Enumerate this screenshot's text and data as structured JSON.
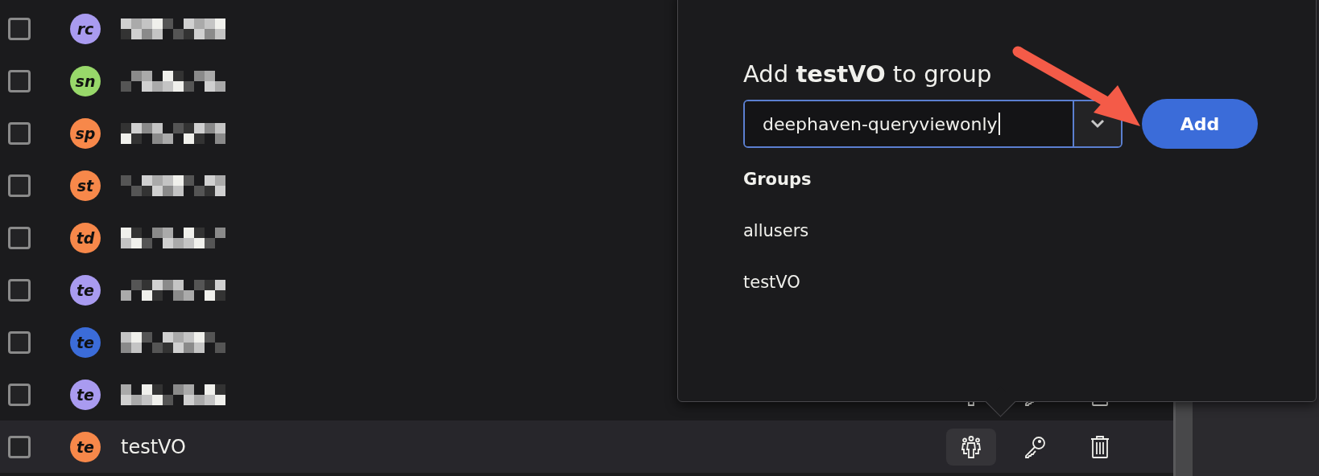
{
  "users": [
    {
      "kind": "redacted",
      "initials": "rc",
      "color": "#a99bf0",
      "checked": false,
      "hovered": false
    },
    {
      "kind": "redacted",
      "initials": "sn",
      "color": "#98d86a",
      "checked": false,
      "hovered": false
    },
    {
      "kind": "redacted",
      "initials": "sp",
      "color": "#f7884a",
      "checked": false,
      "hovered": false
    },
    {
      "kind": "redacted",
      "initials": "st",
      "color": "#f7884a",
      "checked": false,
      "hovered": false
    },
    {
      "kind": "redacted",
      "initials": "td",
      "color": "#f7884a",
      "checked": false,
      "hovered": false
    },
    {
      "kind": "redacted",
      "initials": "te",
      "color": "#a99bf0",
      "checked": false,
      "hovered": false
    },
    {
      "kind": "redacted",
      "initials": "te",
      "color": "#3b6cd9",
      "checked": false,
      "hovered": false
    },
    {
      "kind": "redacted",
      "initials": "te",
      "color": "#a99bf0",
      "checked": false,
      "actions": true,
      "hovered": false,
      "group_active": false
    },
    {
      "kind": "named",
      "initials": "te",
      "color": "#f7884a",
      "name": "testVO",
      "checked": false,
      "actions": true,
      "hovered": true,
      "group_active": true
    }
  ],
  "popover": {
    "title": "Add **testVO** to group",
    "input": {
      "value": "deephaven-queryviewonly"
    },
    "add_button": "Add",
    "groups_label": "Groups",
    "groups": [
      "allusers",
      "testVO"
    ]
  }
}
